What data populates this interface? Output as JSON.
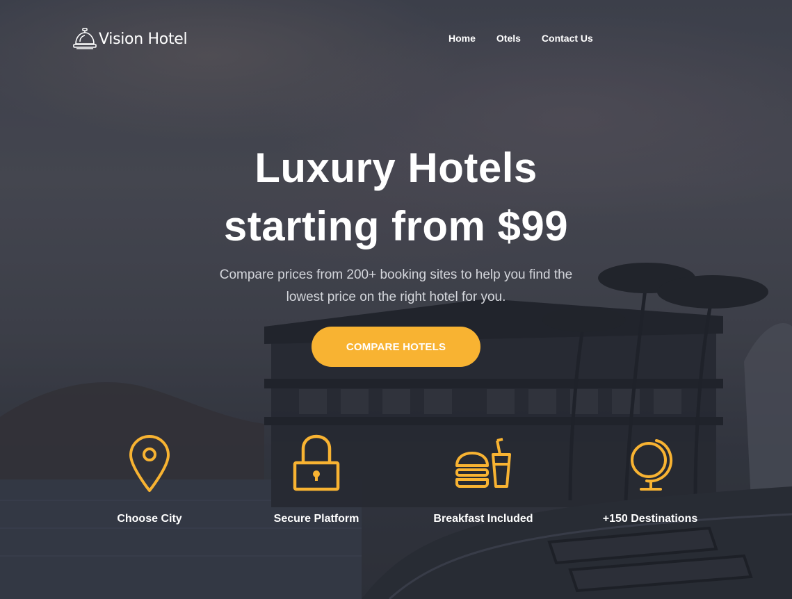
{
  "colors": {
    "accent": "#f8b332",
    "text": "#ffffff",
    "subtext": "#d4d6dc"
  },
  "header": {
    "brand": "Vision Hotel",
    "brand_icon": "service-bell-icon",
    "nav": [
      {
        "label": "Home"
      },
      {
        "label": "Otels"
      },
      {
        "label": "Contact Us"
      }
    ]
  },
  "hero": {
    "title_line1": "Luxury Hotels",
    "title_line2": "starting from $99",
    "subtitle_line1": "Compare prices from 200+ booking sites to help you find the",
    "subtitle_line2": "lowest price on the right hotel for you.",
    "cta_label": "COMPARE HOTELS"
  },
  "features": [
    {
      "icon": "map-pin-icon",
      "label": "Choose City"
    },
    {
      "icon": "padlock-icon",
      "label": "Secure Platform"
    },
    {
      "icon": "burger-drink-icon",
      "label": "Breakfast Included"
    },
    {
      "icon": "globe-icon",
      "label": "+150 Destinations"
    }
  ]
}
